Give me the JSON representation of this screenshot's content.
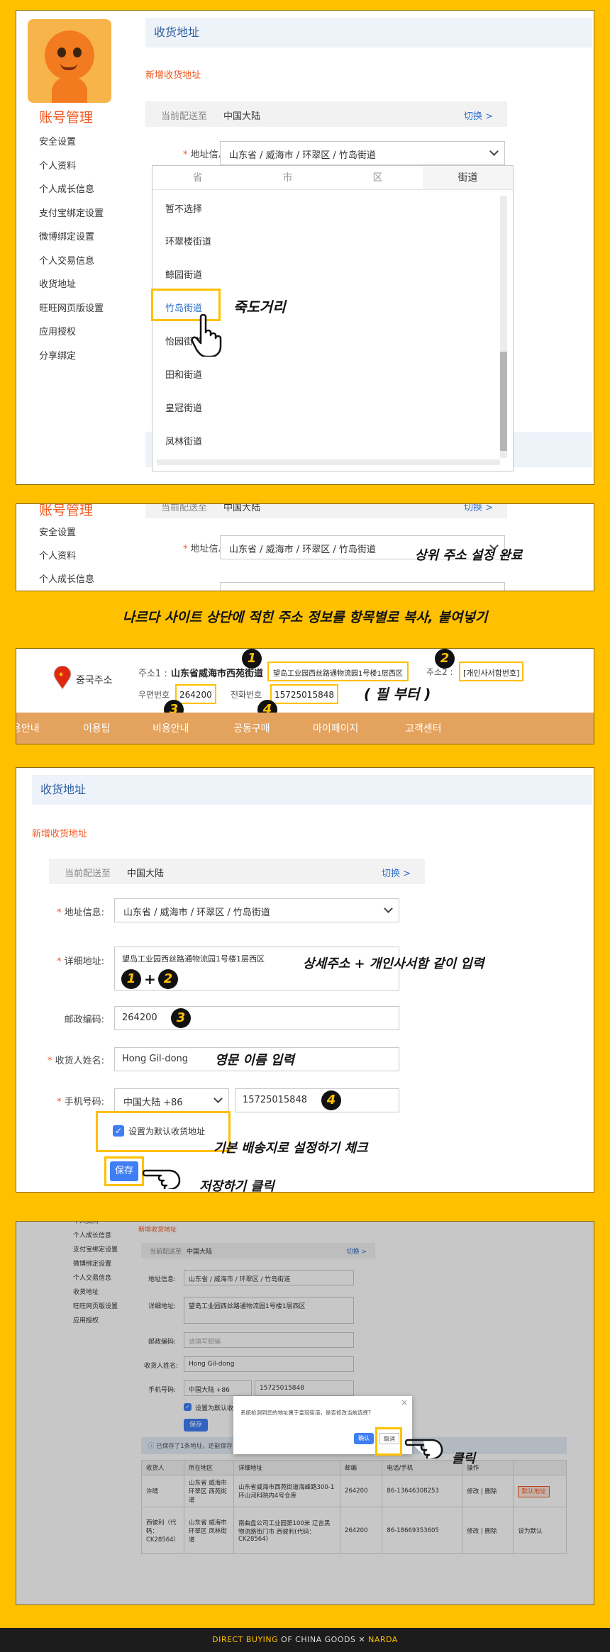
{
  "sidebar": {
    "title": "账号管理",
    "items": [
      "安全设置",
      "个人资料",
      "个人成长信息",
      "支付宝绑定设置",
      "微博绑定设置",
      "个人交易信息",
      "收货地址",
      "旺旺网页版设置",
      "应用授权",
      "分享绑定"
    ]
  },
  "page": {
    "title": "收货地址",
    "new_address": "新增收货地址",
    "current_dest_label": "当前配送至",
    "current_dest_value": "中国大陆",
    "switch_link": "切换 >"
  },
  "panel1": {
    "address_label": "地址信息:",
    "address_value": "山东省 / 威海市 / 环翠区 / 竹岛街道",
    "tabs": [
      "省",
      "市",
      "区",
      "街道"
    ],
    "options": [
      "暂不选择",
      "环翠楼街道",
      "鲸园街道",
      "竹岛街道",
      "怡园街道",
      "田和街道",
      "皇冠街道",
      "凤林街道"
    ],
    "selected_note": "죽도거리"
  },
  "panel2": {
    "current_dest_label": "当前配送至",
    "current_dest_value": "中国大陆",
    "switch_link": "切换 >",
    "address_label": "地址信息:",
    "address_value": "山东省 / 威海市 / 环翠区 / 竹岛街道",
    "note": "상위 주소 설정 완료"
  },
  "banner_note": "나르다 사이트 상단에 적힌 주소 정보를 항목별로 복사, 붙여넣기",
  "panel3": {
    "country": "중국주소",
    "addr_label": "주소1 :",
    "addr_prefix": "山东省威海市西苑街道",
    "addr_detail": "望岛工业园西丝路通物流园1号楼1层西区",
    "addr2_label": "주소2 :",
    "addr2_value": "[개인사서함번호]",
    "zip_label": "우편번호",
    "zip_value": "264200",
    "phone_label": "전화번호",
    "phone_value": "15725015848",
    "note": "( 필 부터 )",
    "nav": [
      "용안내",
      "이용팁",
      "비용안내",
      "공동구매",
      "마이페이지",
      "고객센터"
    ],
    "badges": [
      "1",
      "2",
      "3",
      "4"
    ]
  },
  "panel4": {
    "title": "收货地址",
    "new_address": "新增收货地址",
    "current_dest_label": "当前配送至",
    "current_dest_value": "中国大陆",
    "switch_link": "切换 >",
    "address_label": "地址信息:",
    "address_value": "山东省 / 威海市 / 环翠区 / 竹岛街道",
    "detail_label": "详细地址:",
    "detail_value": "望岛工业园西丝路通物流园1号楼1层西区",
    "detail_note": "상세주소 + 개인사서함 같이 입력",
    "plus": "+",
    "zip_label": "邮政编码:",
    "zip_value": "264200",
    "name_label": "收货人姓名:",
    "name_value": "Hong Gil-dong",
    "name_note": "영문 이름 입력",
    "phone_label": "手机号码:",
    "phone_country": "中国大陆 +86",
    "phone_value": "15725015848",
    "default_label": "设置为默认收货地址",
    "default_note": "기본 배송지로 설정하기 체크",
    "save_label": "保存",
    "save_note": "저장하기 클릭"
  },
  "panel5": {
    "sidebar_items": [
      "个人资料",
      "个人成长信息",
      "支付宝绑定设置",
      "微博绑定设置",
      "个人交易信息",
      "收货地址",
      "旺旺网页版设置",
      "应用授权"
    ],
    "new_address": "新增收货地址",
    "current_dest_label": "当前配送至",
    "current_dest_value": "中国大陆",
    "switch_link": "切换 >",
    "address_label": "地址信息:",
    "address_value": "山东省 / 威海市 / 环翠区 / 竹岛街道",
    "detail_label": "详细地址:",
    "detail_value": "望岛工业园西丝路通物流园1号楼1层西区",
    "zip_label": "邮政编码:",
    "zip_placeholder": "请填写邮编",
    "name_label": "收货人姓名:",
    "name_value": "Hong Gil-dong",
    "phone_label": "手机号码:",
    "phone_country": "中国大陆 +86",
    "phone_value": "15725015848",
    "default_label": "设置为默认收货地址",
    "save_label": "保存",
    "info_text": "已保存了1条地址，还能保存",
    "dialog_text": "系统检测到您的地址属于皇冠街道，是否修改当前选择？",
    "confirm_label": "确认",
    "cancel_label": "取消",
    "click_note": "클릭",
    "table_headers": [
      "收货人",
      "所在地区",
      "详细地址",
      "邮编",
      "电话/手机",
      "操作",
      ""
    ],
    "rows": [
      {
        "name": "许晴",
        "region": "山东省 威海市 环翠区 西苑街道",
        "detail": "山东省威海市西苑街道海峰路300-1环山河科院内4号仓库",
        "zip": "264200",
        "phone": "86-13646308253",
        "ops": "修改 | 删除",
        "extra": "默认地址"
      },
      {
        "name": "西彼利（代码：CK28564）",
        "region": "山东省 威海市 环翠区 凤林街道",
        "detail": "南曲盘公司工业园第100米 辽吉黑物流路街门市 西彼利(代码：CK28564)",
        "zip": "264200",
        "phone": "86-18669353605",
        "ops": "修改 | 删除",
        "extra": "设为默认"
      }
    ]
  },
  "footer": {
    "part1": "DIRECT BUYING",
    "part2": " OF CHINA GOODS",
    "sep": "  ✕  ",
    "brand": "NARDA"
  },
  "colors": {
    "background": "#ffc000",
    "accent_orange": "#f05a22",
    "link_blue": "#2e6fcc",
    "button_blue": "#3f7ef5",
    "nav_bar": "#e3a25e"
  }
}
